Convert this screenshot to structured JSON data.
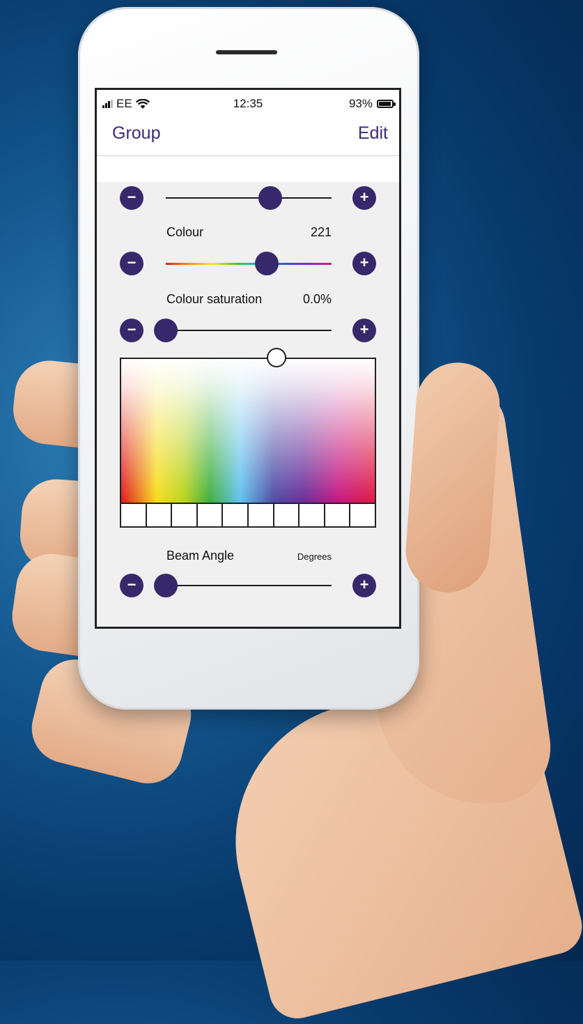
{
  "status_bar": {
    "carrier": "EE",
    "time": "12:35",
    "battery_text": "93%",
    "battery_level": 0.93
  },
  "nav": {
    "back_label": "Group",
    "edit_label": "Edit"
  },
  "controls": {
    "minus_glyph": "−",
    "plus_glyph": "+",
    "brightness": {
      "level": 0.63
    },
    "colour": {
      "label": "Colour",
      "value": "221",
      "level": 0.61
    },
    "saturation": {
      "label": "Colour saturation",
      "value": "0.0%",
      "level": 0.0
    },
    "beam": {
      "label": "Beam Angle",
      "value": "Degrees",
      "level": 0.0
    }
  },
  "colors": {
    "accent": "#37286b",
    "nav_text": "#3d2a78",
    "panel_bg": "#f0f0f0"
  },
  "swatch_count": 10
}
